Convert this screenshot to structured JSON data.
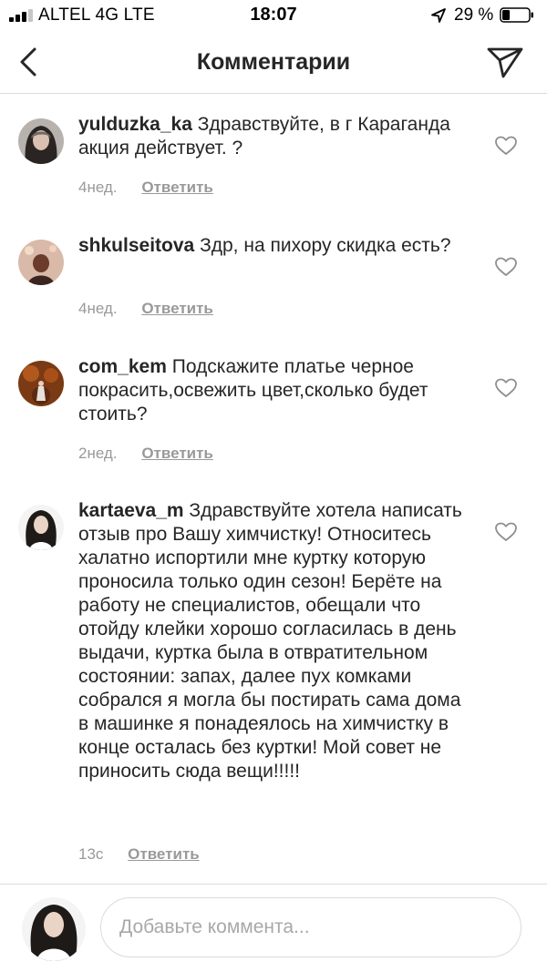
{
  "status_bar": {
    "carrier": "ALTEL 4G   LTE",
    "time": "18:07",
    "battery": "29 %",
    "battery_level": 0.29
  },
  "header": {
    "title": "Комментарии",
    "back_icon": "chevron-left-icon",
    "send_icon": "paper-plane-icon"
  },
  "comments": [
    {
      "username": "yulduzka_ka",
      "text": " Здравствуйте, в г Караганда акция действует. ?",
      "time": "4нед.",
      "reply": "Ответить"
    },
    {
      "username": "shkulseitova",
      "text": " Здр, на пихору скидка есть?",
      "time": "4нед.",
      "reply": "Ответить"
    },
    {
      "username": "com_kem",
      "text": " Подскажите платье черное покрасить,освежить цвет,сколько будет стоить?",
      "time": "2нед.",
      "reply": "Ответить"
    },
    {
      "username": "kartaeva_m",
      "text": " Здравствуйте хотела написать отзыв про Вашу химчистку! Относитесь халатно испортили мне куртку которую проносила только один сезон! Берёте на работу не специалистов, обещали что отойду клейки хорошо согласилась в день выдачи, куртка была в отвратительном состоянии: запах, далее пух комками собрался я могла бы постирать сама дома в машинке я понадеялось на химчистку в конце осталась без куртки! Мой совет не приносить сюда вещи!!!!!",
      "time": "13с",
      "reply": "Ответить"
    }
  ],
  "composer": {
    "placeholder": "Добавьте коммента..."
  },
  "colors": {
    "text": "#262626",
    "muted": "#999999",
    "divider": "#dbdbdb"
  }
}
